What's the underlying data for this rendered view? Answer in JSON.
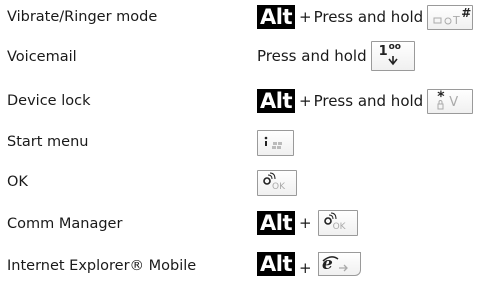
{
  "rows": [
    {
      "label": "Vibrate/Ringer mode",
      "modifier": "Alt",
      "plus": "+",
      "action": "Press and hold",
      "key_glyph": "#",
      "key_icon": "ringer-vibrate-key-icon"
    },
    {
      "label": "Voicemail",
      "action": "Press and hold",
      "key_glyph": "1",
      "key_sub": "oo",
      "key_icon": "voicemail-key-icon"
    },
    {
      "label": "Device lock",
      "modifier": "Alt",
      "plus": "+",
      "action": "Press and hold",
      "key_glyph": "*",
      "key_letter": "V",
      "key_icon": "lock-key-icon"
    },
    {
      "label": "Start menu",
      "key_icon": "windows-start-key-icon"
    },
    {
      "label": "OK",
      "key_sub": "OK",
      "key_icon": "ok-key-icon"
    },
    {
      "label": "Comm Manager",
      "modifier": "Alt",
      "plus": "+",
      "key_sub": "OK",
      "key_icon": "ok-key-icon"
    },
    {
      "label": "Internet Explorer® Mobile",
      "modifier": "Alt",
      "plus": "+",
      "key_icon": "internet-explorer-key-icon"
    }
  ]
}
